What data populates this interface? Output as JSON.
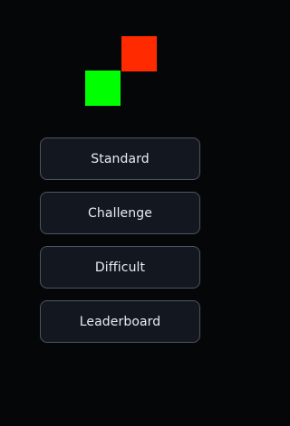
{
  "logo": {
    "tiles": [
      {
        "name": "red-tile",
        "color": "#ff2a00"
      },
      {
        "name": "green-tile",
        "color": "#00ff00"
      }
    ]
  },
  "menu": {
    "items": [
      {
        "label": "Standard"
      },
      {
        "label": "Challenge"
      },
      {
        "label": "Difficult"
      },
      {
        "label": "Leaderboard"
      }
    ]
  },
  "colors": {
    "background": "#050608",
    "button_fill": "#131820",
    "button_border": "#4d5562",
    "button_text": "#e8ecf1"
  }
}
